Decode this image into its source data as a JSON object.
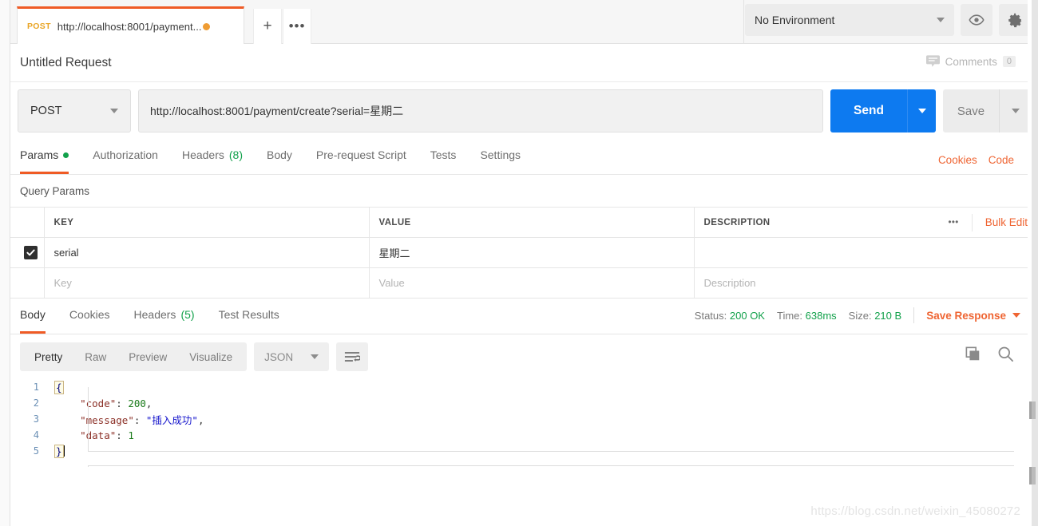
{
  "window": {
    "tab": {
      "method": "POST",
      "url_label": "http://localhost:8001/payment...",
      "unsaved": true
    },
    "new_tab_label": "+",
    "tab_options_label": "•••",
    "environment": {
      "selected": "No Environment"
    },
    "icons": {
      "eye": "eye-icon",
      "gear": "gear-icon"
    }
  },
  "request": {
    "title": "Untitled Request",
    "comments_label": "Comments",
    "comments_count": "0",
    "method": "POST",
    "url": "http://localhost:8001/payment/create?serial=星期二",
    "send_label": "Send",
    "save_label": "Save",
    "tabs": [
      {
        "label": "Params",
        "badge": "",
        "dot": true,
        "active": true
      },
      {
        "label": "Authorization",
        "badge": "",
        "dot": false,
        "active": false
      },
      {
        "label": "Headers",
        "badge": "(8)",
        "dot": false,
        "active": false
      },
      {
        "label": "Body",
        "badge": "",
        "dot": false,
        "active": false
      },
      {
        "label": "Pre-request Script",
        "badge": "",
        "dot": false,
        "active": false
      },
      {
        "label": "Tests",
        "badge": "",
        "dot": false,
        "active": false
      },
      {
        "label": "Settings",
        "badge": "",
        "dot": false,
        "active": false
      }
    ],
    "cookies_label": "Cookies",
    "code_label": "Code"
  },
  "params": {
    "section_label": "Query Params",
    "headers": {
      "key": "KEY",
      "value": "VALUE",
      "description": "DESCRIPTION",
      "more": "•••",
      "bulk_edit": "Bulk Edit"
    },
    "rows": [
      {
        "enabled": true,
        "key": "serial",
        "value": "星期二",
        "description": ""
      }
    ],
    "placeholders": {
      "key": "Key",
      "value": "Value",
      "description": "Description"
    }
  },
  "response": {
    "tabs": [
      {
        "label": "Body",
        "badge": "",
        "active": true
      },
      {
        "label": "Cookies",
        "badge": "",
        "active": false
      },
      {
        "label": "Headers",
        "badge": "(5)",
        "active": false
      },
      {
        "label": "Test Results",
        "badge": "",
        "active": false
      }
    ],
    "status_label": "Status:",
    "status_value": "200 OK",
    "time_label": "Time:",
    "time_value": "638ms",
    "size_label": "Size:",
    "size_value": "210 B",
    "save_response_label": "Save Response",
    "view_modes": [
      {
        "label": "Pretty",
        "active": true
      },
      {
        "label": "Raw",
        "active": false
      },
      {
        "label": "Preview",
        "active": false
      },
      {
        "label": "Visualize",
        "active": false
      }
    ],
    "format": "JSON",
    "icons": {
      "wrap": "wrap-lines-icon",
      "copy": "copy-icon",
      "search": "search-icon"
    },
    "body_lines": [
      {
        "no": "1",
        "tokens": [
          {
            "t": "{",
            "c": "brace"
          }
        ]
      },
      {
        "no": "2",
        "tokens": [
          {
            "t": "    ",
            "c": "p"
          },
          {
            "t": "\"code\"",
            "c": "k"
          },
          {
            "t": ": ",
            "c": "p"
          },
          {
            "t": "200",
            "c": "n"
          },
          {
            "t": ",",
            "c": "p"
          }
        ]
      },
      {
        "no": "3",
        "tokens": [
          {
            "t": "    ",
            "c": "p"
          },
          {
            "t": "\"message\"",
            "c": "k"
          },
          {
            "t": ": ",
            "c": "p"
          },
          {
            "t": "\"插入成功\"",
            "c": "s"
          },
          {
            "t": ",",
            "c": "p"
          }
        ]
      },
      {
        "no": "4",
        "tokens": [
          {
            "t": "    ",
            "c": "p"
          },
          {
            "t": "\"data\"",
            "c": "k"
          },
          {
            "t": ": ",
            "c": "p"
          },
          {
            "t": "1",
            "c": "n"
          }
        ]
      },
      {
        "no": "5",
        "tokens": [
          {
            "t": "}",
            "c": "brace"
          }
        ]
      }
    ]
  },
  "watermark": "https://blog.csdn.net/weixin_45080272",
  "colors": {
    "accent_orange": "#ef5b25",
    "send_blue": "#0d7af0",
    "status_green": "#12a14b",
    "method_amber": "#e9a526"
  }
}
